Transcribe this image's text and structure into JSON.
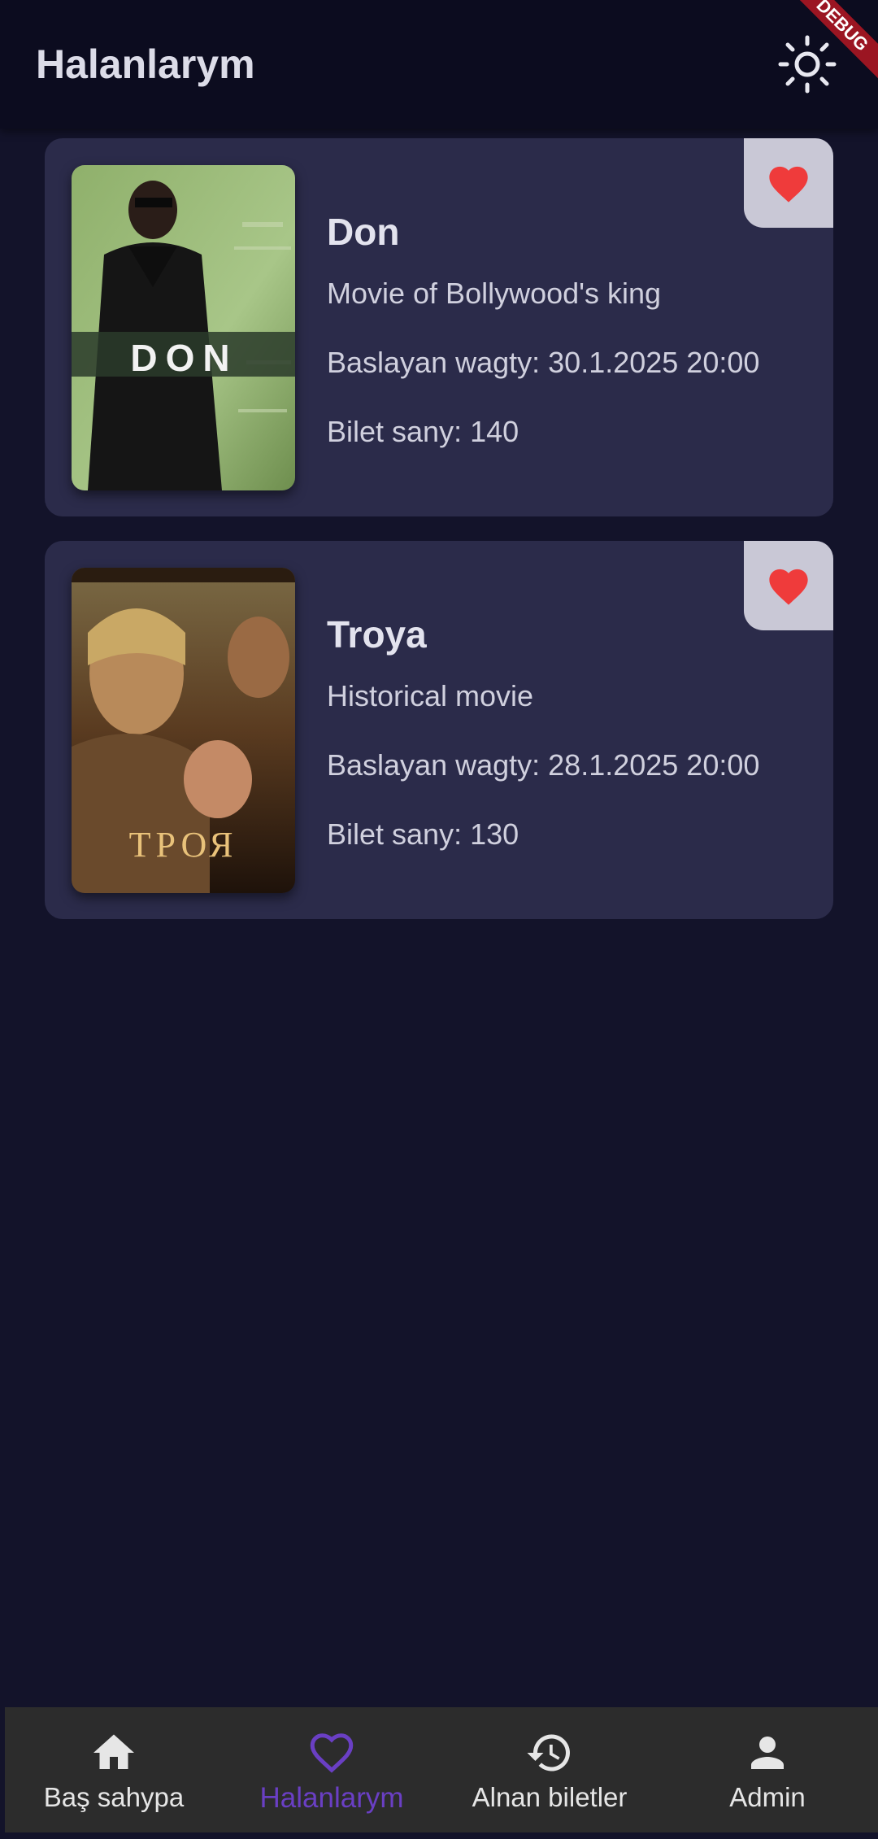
{
  "app": {
    "title": "Halanlarym",
    "theme_icon": "sun-icon",
    "debug_banner": "DEBUG"
  },
  "movies": [
    {
      "title": "Don",
      "description": "Movie of Bollywood's king",
      "start": "Baslayan wagty: 30.1.2025 20:00",
      "tickets": "Bilet sany: 140",
      "poster_text": "DON",
      "favorite_icon": "heart-icon",
      "favorite": true
    },
    {
      "title": "Troya",
      "description": "Historical movie",
      "start": "Baslayan wagty: 28.1.2025 20:00",
      "tickets": "Bilet sany: 130",
      "poster_text": "ТРОЯ",
      "favorite_icon": "heart-icon",
      "favorite": true
    }
  ],
  "nav": {
    "items": [
      {
        "label": "Baş sahypa",
        "icon": "home-icon",
        "active": false
      },
      {
        "label": "Halanlarym",
        "icon": "heart-outline-icon",
        "active": true
      },
      {
        "label": "Alnan biletler",
        "icon": "history-icon",
        "active": false
      },
      {
        "label": "Admin",
        "icon": "person-icon",
        "active": false
      }
    ]
  },
  "colors": {
    "background": "#13132a",
    "card": "#2b2b4a",
    "accent": "#6a3fc4",
    "heart": "#ef3b3b"
  }
}
